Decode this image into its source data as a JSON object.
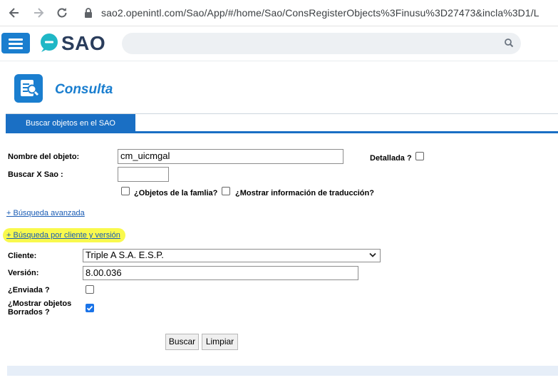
{
  "browser": {
    "url": "sao2.openintl.com/Sao/App/#/home/Sao/ConsRegisterObjects%3Finusu%3D27473&incla%3D1/L",
    "back_icon": "arrow-left-icon",
    "forward_icon": "arrow-right-icon",
    "reload_icon": "reload-icon",
    "lock_icon": "lock-icon"
  },
  "app": {
    "logo_text": "SAO",
    "accent": "#1a7ecf",
    "search_placeholder": ""
  },
  "page": {
    "title": "Consulta",
    "tab_label": "Buscar objetos en el SAO"
  },
  "form": {
    "nombre_label": "Nombre del objeto:",
    "nombre_value": "cm_uicmgal",
    "detallada_label": "Detallada ?",
    "buscar_sao_label": "Buscar X Sao :",
    "buscar_sao_value": "",
    "familia_label": "¿Objetos de la famlia?",
    "traduccion_label": "¿Mostrar información de traducción?",
    "busqueda_avanzada": "+ Búsqueda avanzada",
    "busqueda_cliente": "+ Búsqueda por cliente y versión",
    "cliente_label": "Cliente:",
    "cliente_value": "Triple A S.A. E.S.P.",
    "version_label": "Versión:",
    "version_value": "8.00.036",
    "enviada_label": "¿Enviada ?",
    "borrados_label_1": "¿Mostrar objetos",
    "borrados_label_2": "Borrados ?",
    "borrados_checked": true
  },
  "buttons": {
    "buscar": "Buscar",
    "limpiar": "Limpiar"
  }
}
